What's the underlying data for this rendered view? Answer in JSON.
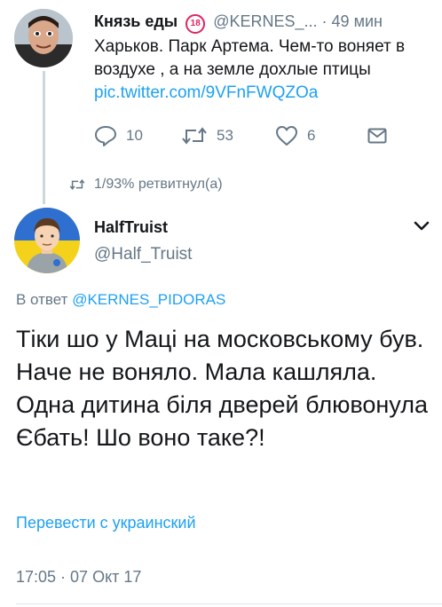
{
  "parent_tweet": {
    "name": "Князь еды",
    "age_badge": "18",
    "handle": "@KERNES_...",
    "time": "· 49 мин",
    "text": "Харьков. Парк Артема. Чем-то воняет в воздухе , а на земле дохлые птицы",
    "link": "pic.twitter.com/9VFnFWQZOa",
    "actions": {
      "replies": "10",
      "retweets": "53",
      "likes": "6"
    }
  },
  "retweet_context": "1/93% ретвитнул(а)",
  "main_tweet": {
    "name": "HalfTruist",
    "handle": "@Half_Truist",
    "reply_prefix": "В ответ",
    "reply_mention": "@KERNES_PIDORAS",
    "text": "Тіки шо у Маці на московському був. Наче не воняло. Мала кашляла. Одна дитина біля дверей блювонула\nЄбать! Шо воно таке?!",
    "translate_label": "Перевести с украинский",
    "timestamp": "17:05 · 07 Окт 17"
  },
  "colors": {
    "link": "#1da1f2",
    "secondary_text": "#657786",
    "primary_text": "#14171a",
    "badge_red": "#e0245e"
  },
  "icons": {
    "reply": "reply-icon",
    "retweet": "retweet-icon",
    "like": "heart-icon",
    "dm": "envelope-icon",
    "more": "chevron-down-icon"
  }
}
